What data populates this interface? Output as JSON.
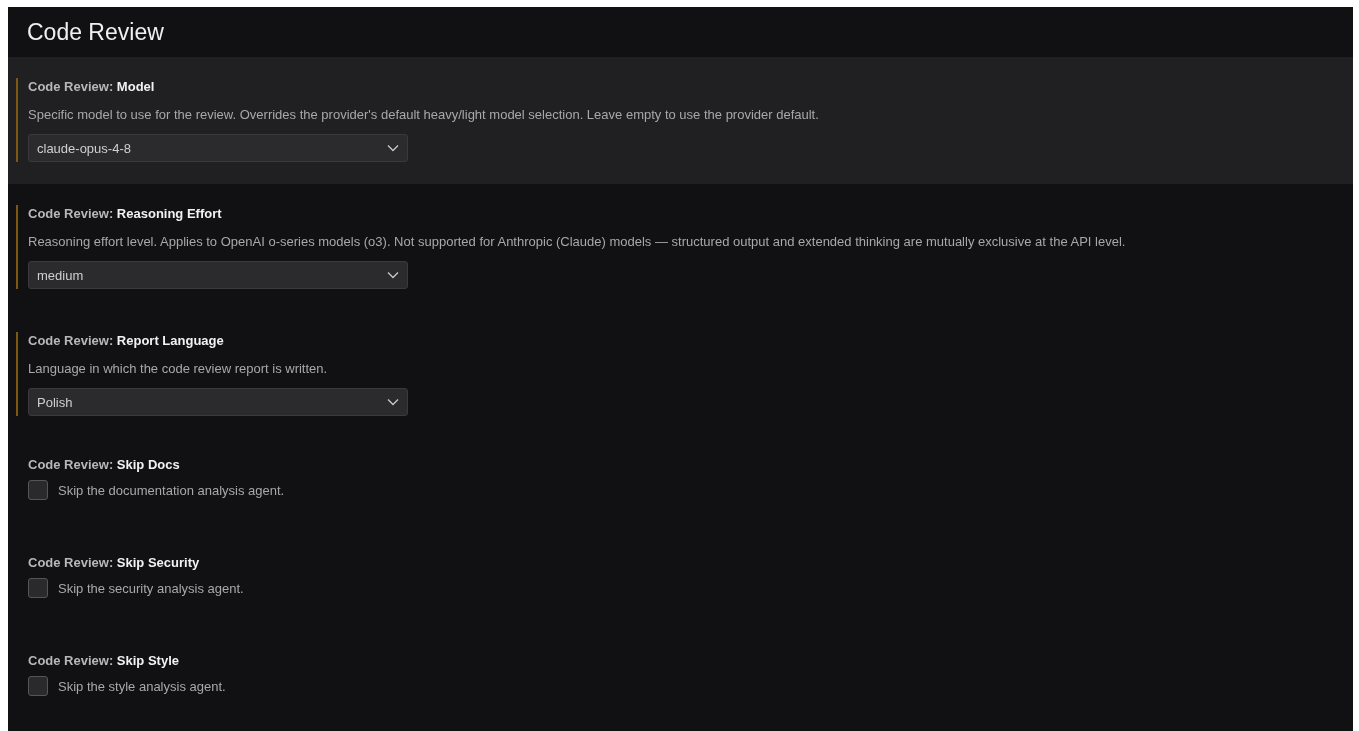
{
  "title": "Code Review",
  "settings": [
    {
      "kind": "select",
      "label": "Code Review: **Model**",
      "modified": true,
      "selected": true,
      "description": "Specific model to use for the review. Overrides the provider's default heavy/light model selection. Leave empty to use the provider default.",
      "value": "claude-opus-4-8"
    },
    {
      "kind": "select",
      "label": "Code Review: **Reasoning Effort**",
      "modified": true,
      "selected": false,
      "description": "Reasoning effort level. Applies to OpenAI o-series models (o3). Not supported for Anthropic (Claude) models — structured output and extended thinking are mutually exclusive at the API level.",
      "value": "medium"
    },
    {
      "kind": "select",
      "label": "Code Review: **Report Language**",
      "modified": true,
      "selected": false,
      "description": "Language in which the code review report is written.",
      "value": "Polish"
    },
    {
      "kind": "checkbox",
      "label": "Code Review: **Skip Docs**",
      "modified": false,
      "selected": false,
      "description": "Skip the documentation analysis agent.",
      "checked": false
    },
    {
      "kind": "checkbox",
      "label": "Code Review: **Skip Security**",
      "modified": false,
      "selected": false,
      "description": "Skip the security analysis agent.",
      "checked": false
    },
    {
      "kind": "checkbox",
      "label": "Code Review: **Skip Style**",
      "modified": false,
      "selected": false,
      "description": "Skip the style analysis agent.",
      "checked": false
    }
  ]
}
